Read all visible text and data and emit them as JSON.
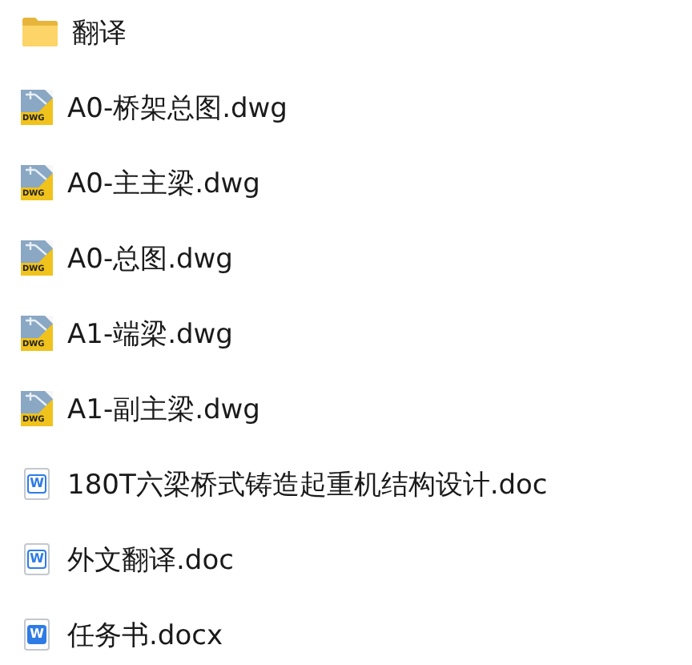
{
  "files": [
    {
      "kind": "folder",
      "name": "翻译"
    },
    {
      "kind": "dwg",
      "name": "A0-桥架总图.dwg",
      "badge": "DWG"
    },
    {
      "kind": "dwg",
      "name": "A0-主主梁.dwg",
      "badge": "DWG"
    },
    {
      "kind": "dwg",
      "name": "A0-总图.dwg",
      "badge": "DWG"
    },
    {
      "kind": "dwg",
      "name": "A1-端梁.dwg",
      "badge": "DWG"
    },
    {
      "kind": "dwg",
      "name": "A1-副主梁.dwg",
      "badge": "DWG"
    },
    {
      "kind": "doc",
      "name": "180T六梁桥式铸造起重机结构设计.doc",
      "badge": "W"
    },
    {
      "kind": "doc",
      "name": "外文翻译.doc",
      "badge": "W"
    },
    {
      "kind": "docx",
      "name": "任务书.docx",
      "badge": "W"
    }
  ]
}
